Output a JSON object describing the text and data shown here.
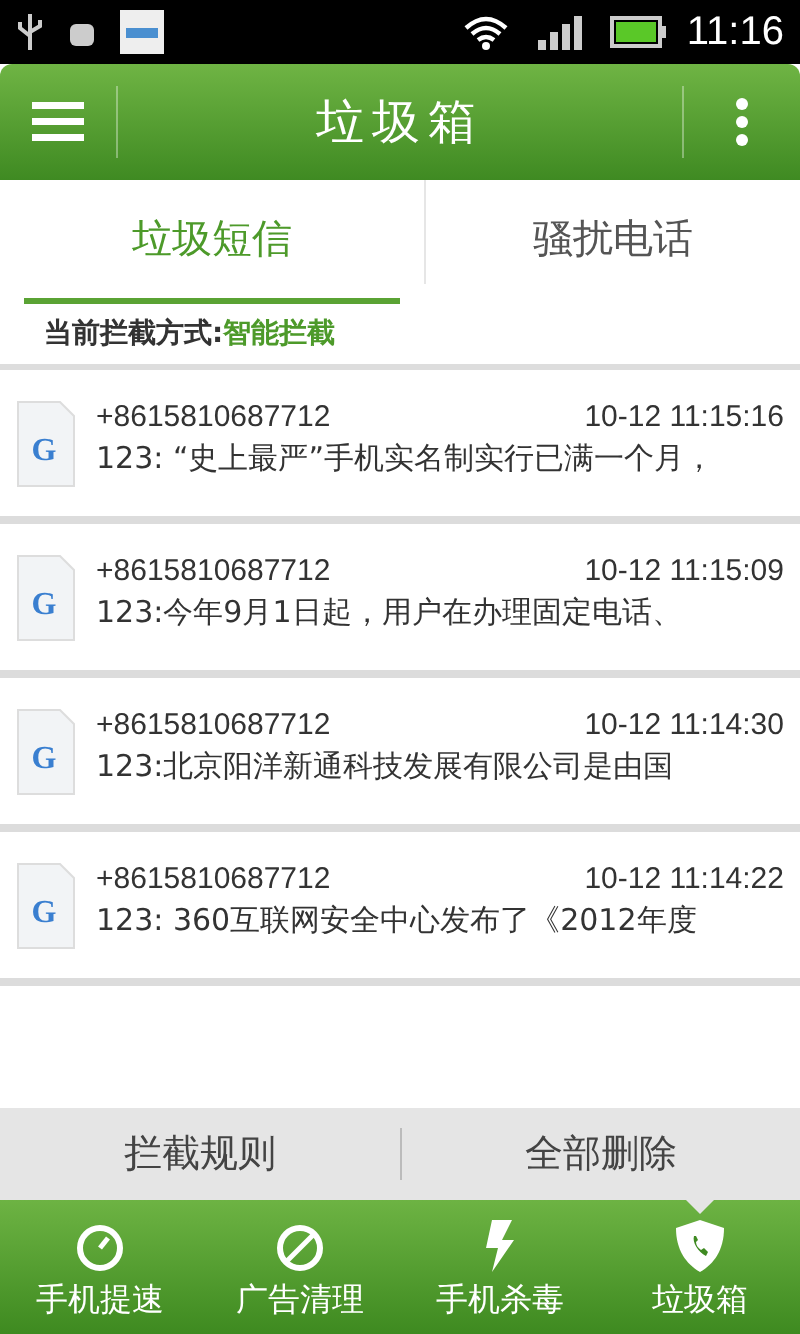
{
  "status_bar": {
    "time": "11:16"
  },
  "header": {
    "title": "垃圾箱"
  },
  "tabs": [
    {
      "label": "垃圾短信",
      "selected": true
    },
    {
      "label": "骚扰电话",
      "selected": false
    }
  ],
  "mode": {
    "label": "当前拦截方式:",
    "value": "智能拦截"
  },
  "messages": [
    {
      "icon_letter": "G",
      "sender": "+8615810687712",
      "time": "10-12 11:15:16",
      "preview": "123: “史上最严”手机实名制实行已满一个月，"
    },
    {
      "icon_letter": "G",
      "sender": "+8615810687712",
      "time": "10-12 11:15:09",
      "preview": "123:今年9月1日起，用户在办理固定电话、"
    },
    {
      "icon_letter": "G",
      "sender": "+8615810687712",
      "time": "10-12 11:14:30",
      "preview": "123:北京阳洋新通科技发展有限公司是由国"
    },
    {
      "icon_letter": "G",
      "sender": "+8615810687712",
      "time": "10-12 11:14:22",
      "preview": "123: 360互联网安全中心发布了《2012年度"
    }
  ],
  "actions": [
    "拦截规则",
    "全部删除"
  ],
  "nav": [
    {
      "kind": "speed",
      "label": "手机提速",
      "selected": false
    },
    {
      "kind": "ads",
      "label": "广告清理",
      "selected": false
    },
    {
      "kind": "virus",
      "label": "手机杀毒",
      "selected": false
    },
    {
      "kind": "trash",
      "label": "垃圾箱",
      "selected": true
    }
  ]
}
